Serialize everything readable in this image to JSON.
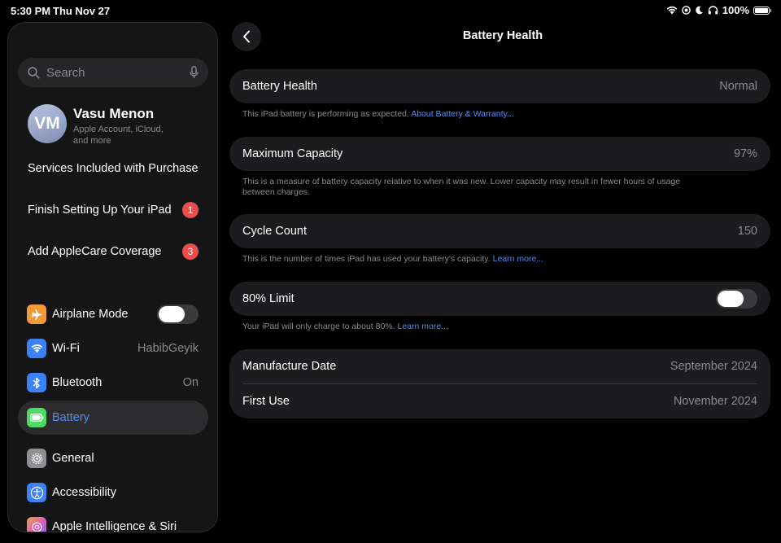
{
  "status_bar": {
    "time": "5:30 PM",
    "date": "Thu Nov 27",
    "battery": "100%"
  },
  "sidebar": {
    "search_placeholder": "Search",
    "profile": {
      "initials": "VM",
      "name": "Vasu Menon",
      "subtitle": "Apple Account, iCloud, and more"
    },
    "services": "Services Included with Purchase",
    "finish_setup": {
      "label": "Finish Setting Up Your iPad",
      "badge": "1"
    },
    "applecare": {
      "label": "Add AppleCare Coverage",
      "badge": "3"
    },
    "items": [
      {
        "label": "Airplane Mode",
        "icon": "airplane-icon",
        "color": "#f19a37"
      },
      {
        "label": "Wi-Fi",
        "value": "HabibGeyik",
        "icon": "wifi-icon",
        "color": "#3b82f6"
      },
      {
        "label": "Bluetooth",
        "value": "On",
        "icon": "bluetooth-icon",
        "color": "#3b82f6"
      },
      {
        "label": "Battery",
        "icon": "battery-icon",
        "color": "#4cd964"
      },
      {
        "label": "General",
        "icon": "gear-icon",
        "color": "#8e8e93"
      },
      {
        "label": "Accessibility",
        "icon": "accessibility-icon",
        "color": "#3b82f6"
      },
      {
        "label": "Apple Intelligence & Siri",
        "icon": "siri-icon",
        "color": "#e07bd6"
      }
    ]
  },
  "main": {
    "title": "Battery Health",
    "battery_health": {
      "label": "Battery Health",
      "value": "Normal",
      "note": "This iPad battery is performing as expected.",
      "link": "About Battery & Warranty..."
    },
    "max_capacity": {
      "label": "Maximum Capacity",
      "value": "97%",
      "note": "This is a measure of battery capacity relative to when it was new. Lower capacity may result in fewer hours of usage between charges."
    },
    "cycle_count": {
      "label": "Cycle Count",
      "value": "150",
      "note": "This is the number of times iPad has used your battery's capacity.",
      "link": "Learn more..."
    },
    "limit": {
      "label": "80% Limit",
      "note": "Your iPad will only charge to about 80%.",
      "link": "Learn more..."
    },
    "manufacture_date": {
      "label": "Manufacture Date",
      "value": "September 2024"
    },
    "first_use": {
      "label": "First Use",
      "value": "November 2024"
    }
  }
}
